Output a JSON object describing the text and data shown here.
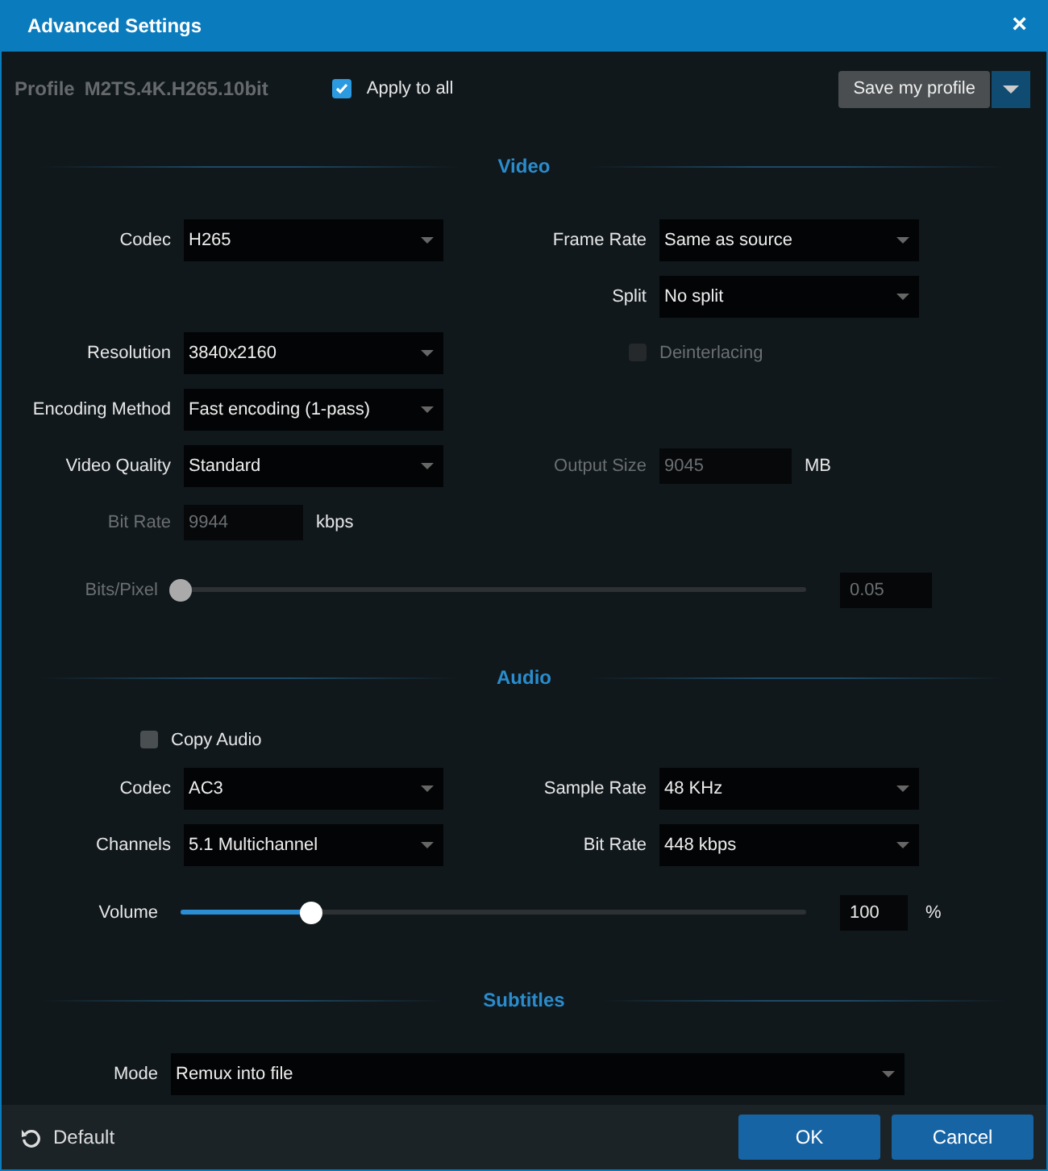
{
  "window": {
    "title": "Advanced Settings",
    "close": "×"
  },
  "profile": {
    "label": "Profile",
    "name": "M2TS.4K.H265.10bit"
  },
  "apply_all": {
    "label": "Apply to all",
    "checked": true
  },
  "save_button": "Save my profile",
  "sections": [
    {
      "title": "Video",
      "rows": [
        {
          "left": {
            "kind": "select",
            "label": "Codec",
            "value": "H265"
          },
          "right": {
            "kind": "select",
            "label": "Frame Rate",
            "value": "Same as source"
          }
        },
        {
          "right": {
            "kind": "select",
            "label": "Split",
            "value": "No split"
          }
        },
        {
          "left": {
            "kind": "select",
            "label": "Resolution",
            "value": "3840x2160"
          },
          "right": {
            "kind": "checkbox",
            "label": "Deinterlacing",
            "checked": false,
            "disabled": true
          }
        },
        {
          "left": {
            "kind": "select",
            "label": "Encoding Method",
            "value": "Fast encoding (1-pass)"
          }
        },
        {
          "left": {
            "kind": "select",
            "label": "Video Quality",
            "value": "Standard"
          },
          "right": {
            "kind": "input",
            "label": "Output Size",
            "value": "9045",
            "unit": "MB",
            "disabled": true
          }
        },
        {
          "left": {
            "kind": "input",
            "label": "Bit Rate",
            "value": "9944",
            "unit": "kbps",
            "disabled": true
          }
        },
        {
          "full": {
            "kind": "slider",
            "label": "Bits/Pixel",
            "level": 0,
            "value": "0.05",
            "disabled": true
          }
        }
      ]
    },
    {
      "title": "Audio",
      "rows": [
        {
          "left": {
            "kind": "checkbox",
            "label": "Copy Audio",
            "checked": false,
            "disabled": false
          }
        },
        {
          "left": {
            "kind": "select",
            "label": "Codec",
            "value": "AC3"
          },
          "right": {
            "kind": "select",
            "label": "Sample Rate",
            "value": "48 KHz"
          }
        },
        {
          "left": {
            "kind": "select",
            "label": "Channels",
            "value": "5.1 Multichannel"
          },
          "right": {
            "kind": "select",
            "label": "Bit Rate",
            "value": "448 kbps"
          }
        },
        {
          "full": {
            "kind": "slider",
            "label": "Volume",
            "level": 0.21,
            "value": "100",
            "unit": "%",
            "disabled": false
          }
        }
      ]
    },
    {
      "title": "Subtitles",
      "rows": [
        {
          "full": {
            "kind": "select",
            "label": "Mode",
            "value": "Remux into file"
          }
        }
      ]
    }
  ],
  "footer": {
    "default": "Default",
    "ok": "OK",
    "cancel": "Cancel"
  }
}
